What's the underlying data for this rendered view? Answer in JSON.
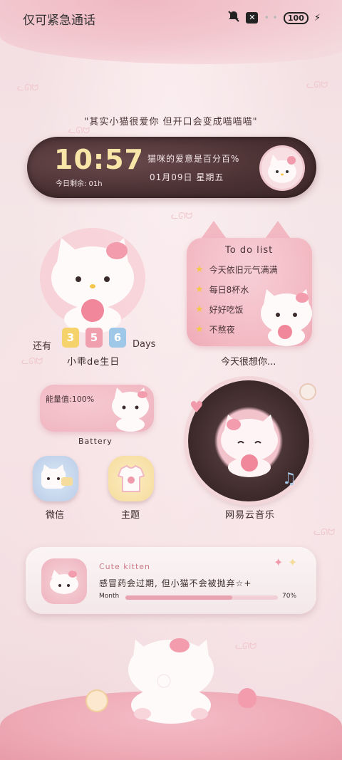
{
  "status_bar": {
    "carrier_text": "仅可紧急通话",
    "x_label": "✕",
    "battery_label": "100"
  },
  "quote": "\"其实小猫很爱你 但开口会变成喵喵喵\"",
  "clock_widget": {
    "time": "10:57",
    "remaining": "今日剩余: 01h",
    "line1": "猫咪的爱意是百分百%",
    "line2": "01月09日   星期五"
  },
  "birthday_widget": {
    "prefix": "还有",
    "digits": [
      "3",
      "5",
      "6"
    ],
    "digit_colors": [
      "#f6d36a",
      "#ef9fad",
      "#9fc7e8"
    ],
    "suffix": "Days",
    "name": "小乖de生日"
  },
  "todo_widget": {
    "title": "To do list",
    "items": [
      "今天依旧元气满满",
      "每日8杯水",
      "好好吃饭",
      "不熬夜"
    ],
    "caption": "今天很想你..."
  },
  "battery_widget": {
    "label": "能量值:100%",
    "caption": "Battery"
  },
  "music_widget": {
    "caption": "网易云音乐"
  },
  "apps": [
    {
      "label": "微信",
      "icon": "wechat-kitty-icon",
      "color": "#b9cde8"
    },
    {
      "label": "主题",
      "icon": "theme-shirt-icon",
      "color": "#f5dc9c"
    }
  ],
  "player": {
    "title": "Cute kitten",
    "lyric": "感冒药会过期, 但小猫不会被抛弃☆+",
    "month_label": "Month",
    "progress": 0.7,
    "percent_label": "70%"
  }
}
